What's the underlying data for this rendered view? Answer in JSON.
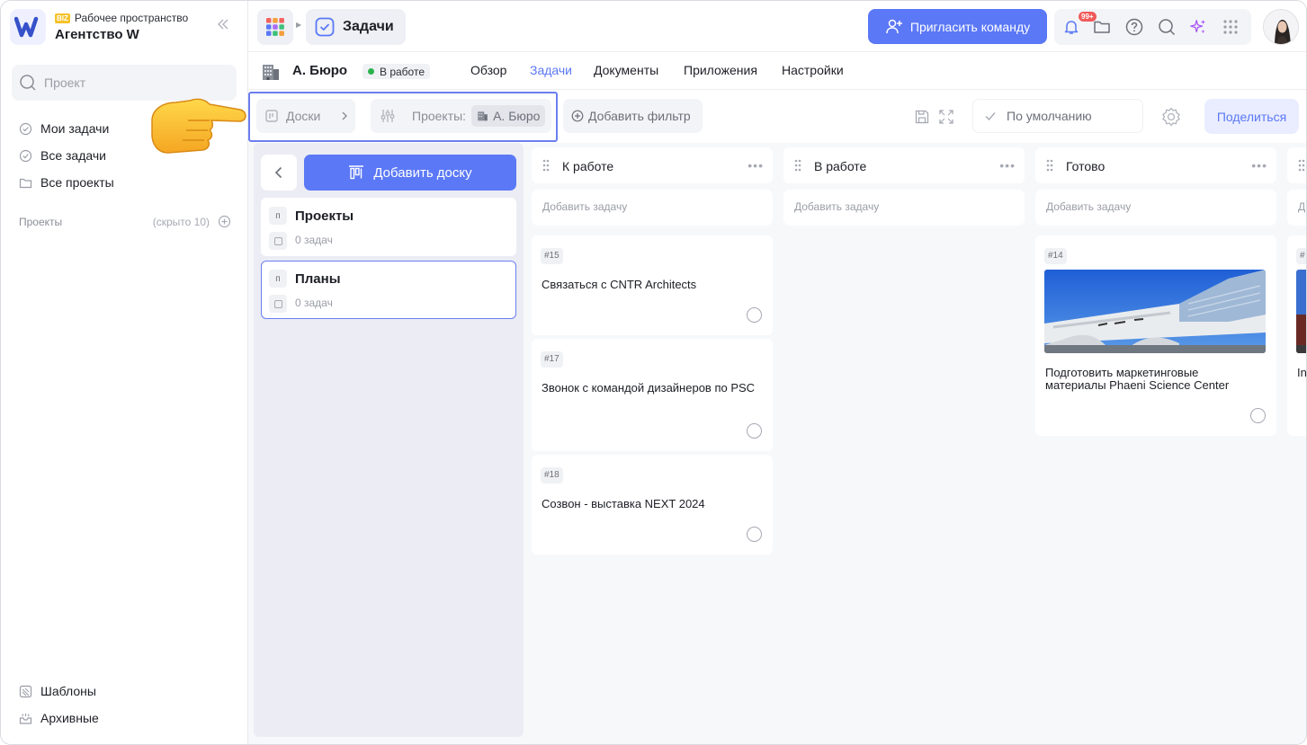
{
  "workspace": {
    "badge": "BIZ",
    "label": "Рабочее пространство",
    "name": "Агентство W"
  },
  "sidebar": {
    "search_placeholder": "Проект",
    "nav": [
      "Мои задачи",
      "Все задачи",
      "Все проекты"
    ],
    "section_title": "Проекты",
    "section_hidden": "(скрыто 10)",
    "bottom": [
      "Шаблоны",
      "Архивные"
    ]
  },
  "header": {
    "section": "Задачи",
    "invite": "Пригласить команду",
    "notif_badge": "99+"
  },
  "project": {
    "name": "А. Бюро",
    "status": "В работе",
    "status_color": "#2bb24c",
    "tabs": [
      "Обзор",
      "Задачи",
      "Документы",
      "Приложения",
      "Настройки"
    ],
    "active_tab": "Задачи"
  },
  "filters": {
    "boards": "Доски",
    "projects_label": "Проекты:",
    "projects_value": "А. Бюро",
    "add_filter": "Добавить фильтр",
    "view": "По умолчанию",
    "share": "Поделиться"
  },
  "boards": {
    "add_label": "Добавить доску",
    "items": [
      {
        "letter": "п",
        "name": "Проекты",
        "count": "0 задач"
      },
      {
        "letter": "п",
        "name": "Планы",
        "count": "0 задач"
      }
    ]
  },
  "columns": [
    {
      "title": "К работе",
      "add_label": "Добавить задачу",
      "cards": [
        {
          "num": "#15",
          "title": "Связаться с CNTR Architects"
        },
        {
          "num": "#17",
          "title": "Звонок с командой дизайнеров по PSC"
        },
        {
          "num": "#18",
          "title": "Созвон - выставка NEXT 2024"
        }
      ]
    },
    {
      "title": "В работе",
      "add_label": "Добавить задачу",
      "cards": []
    },
    {
      "title": "Готово",
      "add_label": "Добавить задачу",
      "cards": [
        {
          "num": "#14",
          "title": "Подготовить маркетинговые материалы Phaeni Science Center",
          "image": "building-photo"
        }
      ]
    },
    {
      "title": "",
      "add_label": "Д",
      "cards": [
        {
          "num": "#",
          "title": "In",
          "image": "building-photo"
        }
      ]
    }
  ],
  "colors": {
    "accent": "#5b78f6",
    "selection": "#6b7ef0"
  }
}
